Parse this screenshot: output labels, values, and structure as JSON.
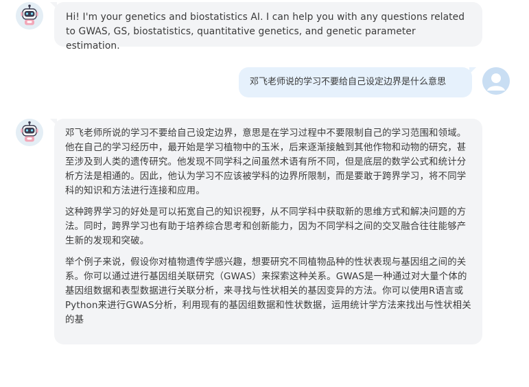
{
  "messages": {
    "greeting": "Hi! I'm your genetics and biostatistics AI. I can help you with any questions related to GWAS, GS, biostatistics, quantitative genetics, and genetic parameter estimation.",
    "user_question": "邓飞老师说的学习不要给自己设定边界是什么意思",
    "answer": {
      "paragraphs": [
        "邓飞老师所说的学习不要给自己设定边界，意思是在学习过程中不要限制自己的学习范围和领域。他在自己的学习经历中，最开始是学习植物中的玉米，后来逐渐接触到其他作物和动物的研究，甚至涉及到人类的遗传研究。他发现不同学科之间虽然术语有所不同，但是底层的数学公式和统计分析方法是相通的。因此，他认为学习不应该被学科的边界所限制，而是要敢于跨界学习，将不同学科的知识和方法进行连接和应用。",
        "这种跨界学习的好处是可以拓宽自己的知识视野，从不同学科中获取新的思维方式和解决问题的方法。同时，跨界学习也有助于培养综合思考和创新能力，因为不同学科之间的交叉融合往往能够产生新的发现和突破。",
        "举个例子来说，假设你对植物遗传学感兴趣，想要研究不同植物品种的性状表现与基因组之间的关系。你可以通过进行基因组关联研究（GWAS）来探索这种关系。GWAS是一种通过对大量个体的基因组数据和表型数据进行关联分析，来寻找与性状相关的基因变异的方法。你可以使用R语言或Python来进行GWAS分析，利用现有的基因组数据和性状数据，运用统计学方法来找出与性状相关的基"
      ]
    }
  },
  "icons": {
    "bot_avatar": "robot-icon",
    "user_avatar": "user-icon"
  },
  "colors": {
    "bot_bubble": "#f3f4f6",
    "user_bubble": "#e6f1fc",
    "user_avatar_bg": "#c9def3",
    "bot_avatar_bg": "#e4eef5",
    "robot_pink": "#f2a7b8"
  }
}
